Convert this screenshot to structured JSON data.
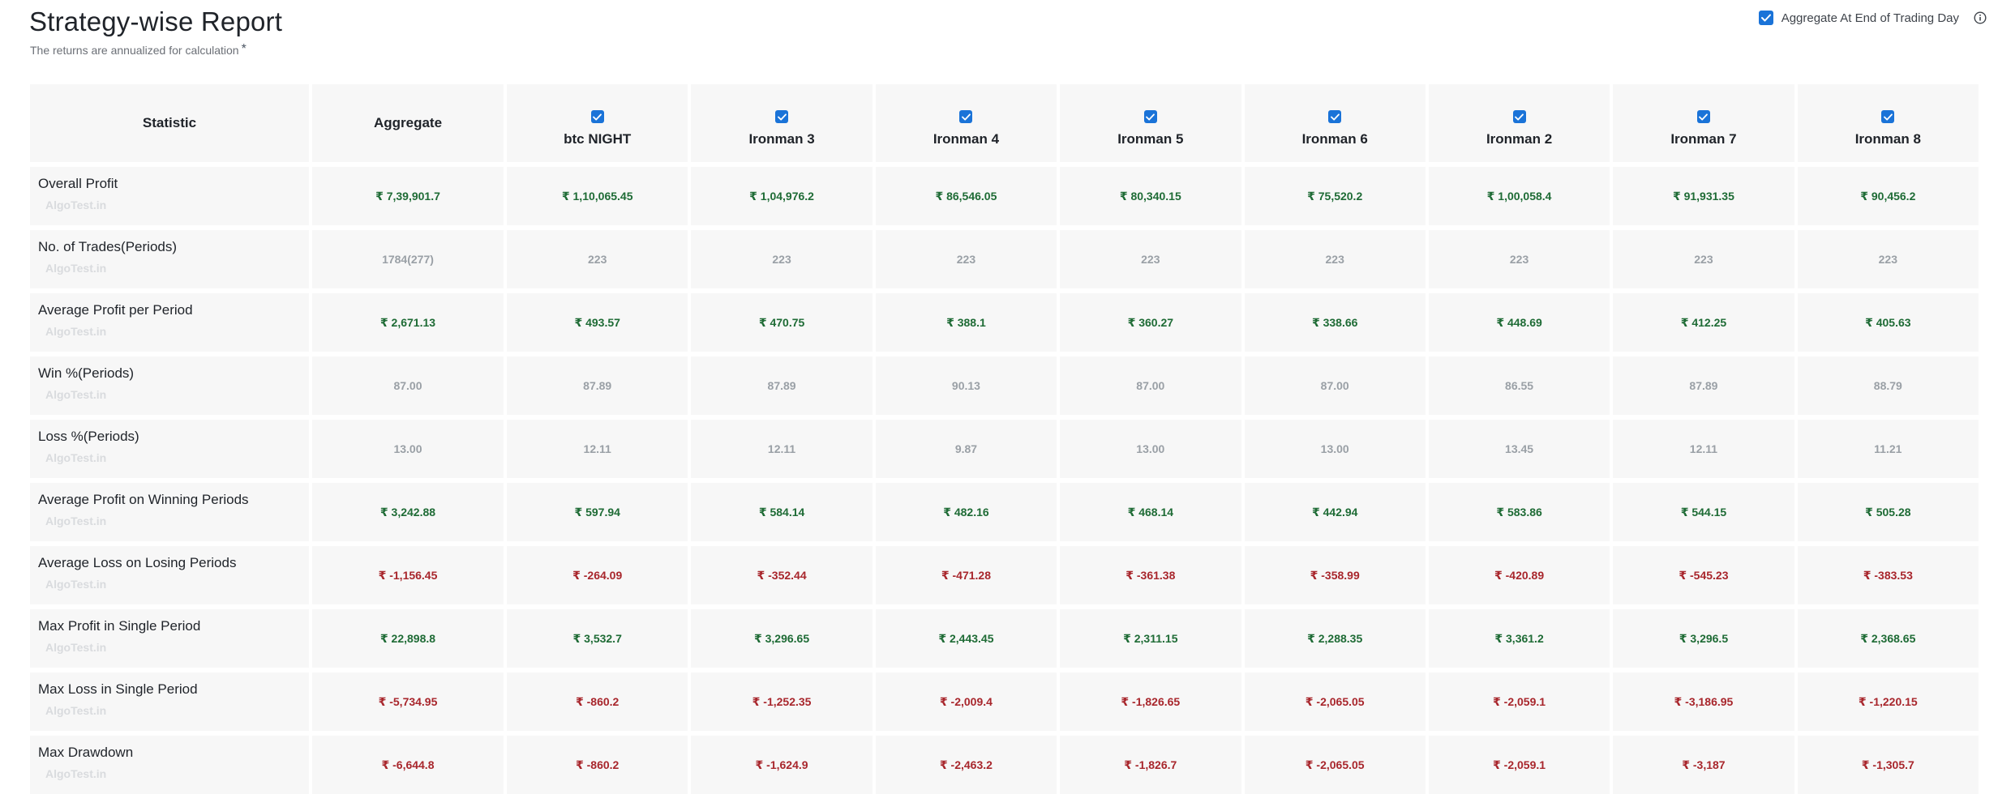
{
  "header": {
    "title": "Strategy-wise Report",
    "subtitle": "The returns are annualized for calculation",
    "subtitle_marker": "*",
    "aggregate_toggle_label": "Aggregate At End of Trading Day",
    "aggregate_toggle_checked": true
  },
  "table": {
    "stat_header": "Statistic",
    "aggregate_header": "Aggregate",
    "watermark": "AlgoTest.in",
    "strategies": [
      {
        "name": "btc NIGHT",
        "checked": true
      },
      {
        "name": "Ironman 3",
        "checked": true
      },
      {
        "name": "Ironman 4",
        "checked": true
      },
      {
        "name": "Ironman 5",
        "checked": true
      },
      {
        "name": "Ironman 6",
        "checked": true
      },
      {
        "name": "Ironman 2",
        "checked": true
      },
      {
        "name": "Ironman 7",
        "checked": true
      },
      {
        "name": "Ironman 8",
        "checked": true
      }
    ],
    "rows": [
      {
        "label": "Overall Profit",
        "tone": "pos",
        "values": [
          "₹ 7,39,901.7",
          "₹ 1,10,065.45",
          "₹ 1,04,976.2",
          "₹ 86,546.05",
          "₹ 80,340.15",
          "₹ 75,520.2",
          "₹ 1,00,058.4",
          "₹ 91,931.35",
          "₹ 90,456.2"
        ]
      },
      {
        "label": "No. of Trades(Periods)",
        "tone": "neutral",
        "values": [
          "1784(277)",
          "223",
          "223",
          "223",
          "223",
          "223",
          "223",
          "223",
          "223"
        ]
      },
      {
        "label": "Average Profit per Period",
        "tone": "pos",
        "values": [
          "₹ 2,671.13",
          "₹ 493.57",
          "₹ 470.75",
          "₹ 388.1",
          "₹ 360.27",
          "₹ 338.66",
          "₹ 448.69",
          "₹ 412.25",
          "₹ 405.63"
        ]
      },
      {
        "label": "Win %(Periods)",
        "tone": "neutral",
        "values": [
          "87.00",
          "87.89",
          "87.89",
          "90.13",
          "87.00",
          "87.00",
          "86.55",
          "87.89",
          "88.79"
        ]
      },
      {
        "label": "Loss %(Periods)",
        "tone": "neutral",
        "values": [
          "13.00",
          "12.11",
          "12.11",
          "9.87",
          "13.00",
          "13.00",
          "13.45",
          "12.11",
          "11.21"
        ]
      },
      {
        "label": "Average Profit on Winning Periods",
        "tone": "pos",
        "values": [
          "₹ 3,242.88",
          "₹ 597.94",
          "₹ 584.14",
          "₹ 482.16",
          "₹ 468.14",
          "₹ 442.94",
          "₹ 583.86",
          "₹ 544.15",
          "₹ 505.28"
        ]
      },
      {
        "label": "Average Loss on Losing Periods",
        "tone": "neg",
        "values": [
          "₹ -1,156.45",
          "₹ -264.09",
          "₹ -352.44",
          "₹ -471.28",
          "₹ -361.38",
          "₹ -358.99",
          "₹ -420.89",
          "₹ -545.23",
          "₹ -383.53"
        ]
      },
      {
        "label": "Max Profit in Single Period",
        "tone": "pos",
        "values": [
          "₹ 22,898.8",
          "₹ 3,532.7",
          "₹ 3,296.65",
          "₹ 2,443.45",
          "₹ 2,311.15",
          "₹ 2,288.35",
          "₹ 3,361.2",
          "₹ 3,296.5",
          "₹ 2,368.65"
        ]
      },
      {
        "label": "Max Loss in Single Period",
        "tone": "neg",
        "values": [
          "₹ -5,734.95",
          "₹ -860.2",
          "₹ -1,252.35",
          "₹ -2,009.4",
          "₹ -1,826.65",
          "₹ -2,065.05",
          "₹ -2,059.1",
          "₹ -3,186.95",
          "₹ -1,220.15"
        ]
      },
      {
        "label": "Max Drawdown",
        "tone": "neg",
        "values": [
          "₹ -6,644.8",
          "₹ -860.2",
          "₹ -1,624.9",
          "₹ -2,463.2",
          "₹ -1,826.7",
          "₹ -2,065.05",
          "₹ -2,059.1",
          "₹ -3,187",
          "₹ -1,305.7"
        ]
      }
    ]
  },
  "colors": {
    "accent": "#1a73d8",
    "positive": "#1e6b35",
    "negative": "#a8262c",
    "neutral": "#9aa0a6",
    "cell_background": "#f7f7f7"
  },
  "icons": {
    "checkbox": "check-icon",
    "info": "info-icon"
  }
}
